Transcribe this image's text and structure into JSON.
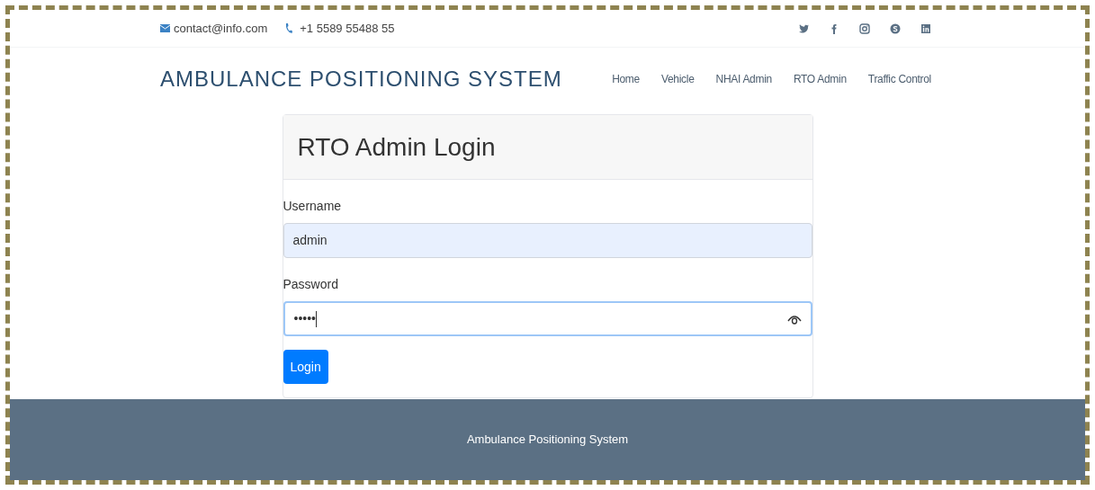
{
  "topbar": {
    "email": "contact@info.com",
    "phone": "+1 5589 55488 55",
    "social": [
      {
        "kind": "twitter"
      },
      {
        "kind": "facebook"
      },
      {
        "kind": "instagram"
      },
      {
        "kind": "skype"
      },
      {
        "kind": "linkedin"
      }
    ]
  },
  "header": {
    "logo": "AMBULANCE POSITIONING SYSTEM",
    "nav": [
      {
        "label": "Home"
      },
      {
        "label": "Vehicle"
      },
      {
        "label": "NHAI Admin"
      },
      {
        "label": "RTO Admin"
      },
      {
        "label": "Traffic Control"
      }
    ]
  },
  "login": {
    "title": "RTO Admin Login",
    "fields": [
      {
        "label": "Username",
        "value": "admin",
        "kind": "text",
        "focused": false
      },
      {
        "label": "Password",
        "value": "•••••",
        "kind": "password",
        "focused": true
      }
    ],
    "button": "Login"
  },
  "footer": {
    "text": "Ambulance Positioning System"
  }
}
